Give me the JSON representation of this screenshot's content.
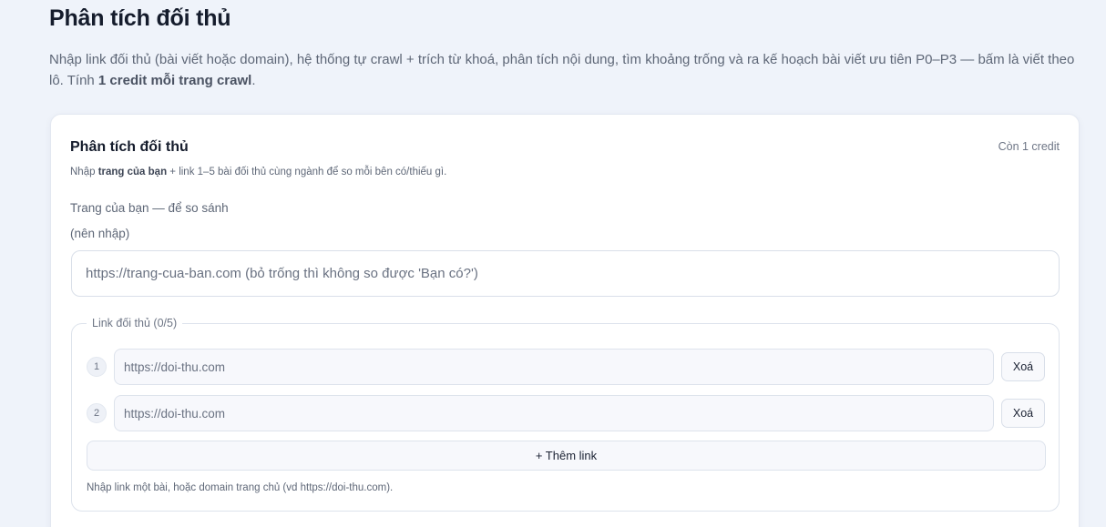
{
  "page": {
    "title": "Phân tích đối thủ",
    "description_main": "Nhập link đối thủ (bài viết hoặc domain), hệ thống tự crawl + trích từ khoá, phân tích nội dung, tìm khoảng trống và ra kế hoạch bài viết ưu tiên P0–P3 — bấm là viết theo lô. Tính ",
    "description_bold": "1 credit mỗi trang crawl",
    "description_end": "."
  },
  "card": {
    "title": "Phân tích đối thủ",
    "credits": "Còn 1 credit",
    "hint_prefix": "Nhập ",
    "hint_bold": "trang của bạn",
    "hint_suffix": " + link 1–5 bài đối thủ cùng ngành để so mỗi bên có/thiếu gì."
  },
  "own_page": {
    "label": "Trang của bạn — để so sánh",
    "sublabel": "(nên nhập)",
    "placeholder": "https://trang-cua-ban.com (bỏ trống thì không so được 'Bạn có?')",
    "value": ""
  },
  "competitors": {
    "legend": "Link đối thủ (0/5)",
    "rows": [
      {
        "index": "1",
        "placeholder": "https://doi-thu.com",
        "value": "",
        "remove_label": "Xoá"
      },
      {
        "index": "2",
        "placeholder": "https://doi-thu.com",
        "value": "",
        "remove_label": "Xoá"
      }
    ],
    "add_label": "+ Thêm link",
    "hint": "Nhập link một bài, hoặc domain trang chủ (vd https://doi-thu.com)."
  }
}
